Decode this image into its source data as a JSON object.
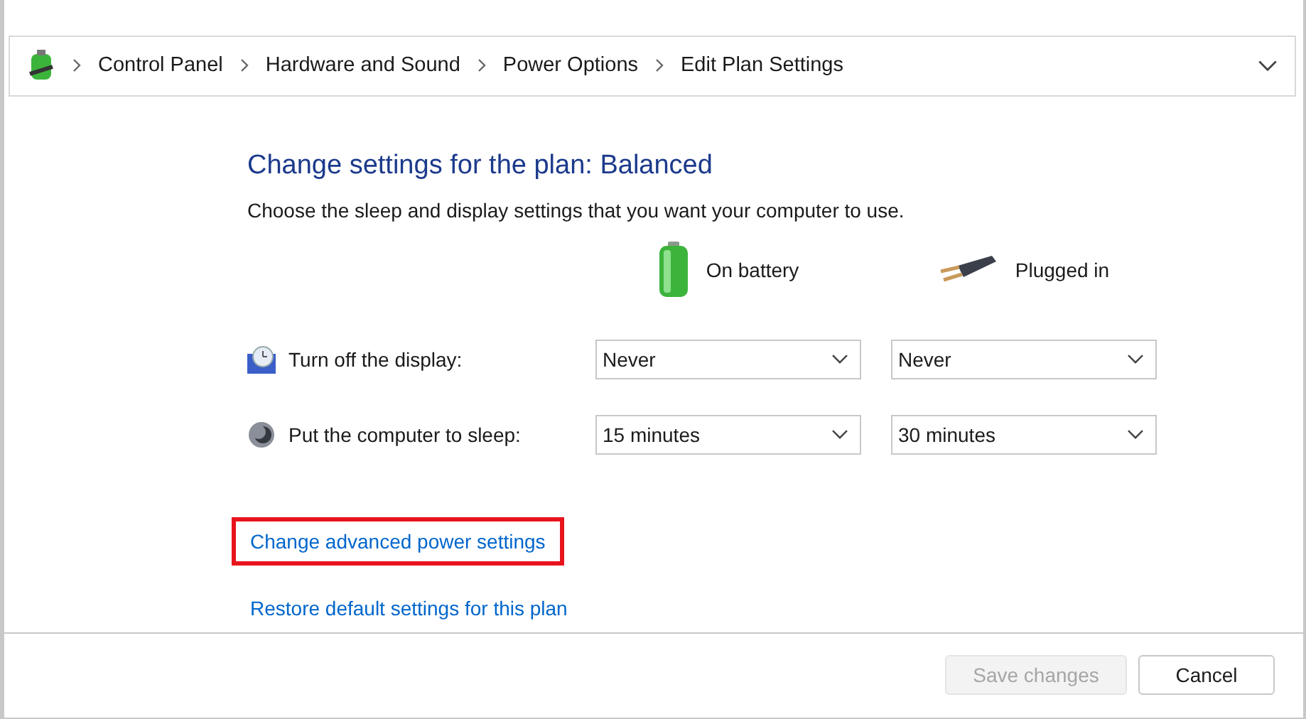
{
  "breadcrumb": [
    "Control Panel",
    "Hardware and Sound",
    "Power Options",
    "Edit Plan Settings"
  ],
  "title": "Change settings for the plan: Balanced",
  "subtitle": "Choose the sleep and display settings that you want your computer to use.",
  "columns": [
    {
      "kind": "battery",
      "label": "On battery"
    },
    {
      "kind": "plug",
      "label": "Plugged in"
    }
  ],
  "settings": [
    {
      "kind": "display",
      "label": "Turn off the display:",
      "values": [
        "Never",
        "Never"
      ]
    },
    {
      "kind": "sleep",
      "label": "Put the computer to sleep:",
      "values": [
        "15 minutes",
        "30 minutes"
      ]
    }
  ],
  "links": [
    {
      "label": "Change advanced power settings",
      "highlighted": true
    },
    {
      "label": "Restore default settings for this plan",
      "highlighted": false
    }
  ],
  "buttons": [
    {
      "label": "Save changes",
      "disabled": true
    },
    {
      "label": "Cancel",
      "disabled": false
    }
  ]
}
